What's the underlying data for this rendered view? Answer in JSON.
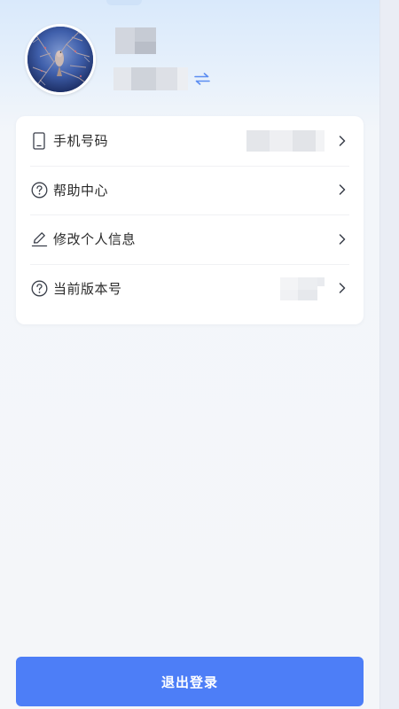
{
  "profile": {
    "avatar_icon": "avatar-photo",
    "switch_icon": "swap-arrows-icon"
  },
  "menu": {
    "items": [
      {
        "label": "手机号码",
        "icon": "phone-icon",
        "has_value": true
      },
      {
        "label": "帮助中心",
        "icon": "question-circle-icon",
        "has_value": false
      },
      {
        "label": "修改个人信息",
        "icon": "pencil-icon",
        "has_value": false
      },
      {
        "label": "当前版本号",
        "icon": "question-circle-icon",
        "has_value": true
      }
    ]
  },
  "logout": {
    "label": "退出登录"
  },
  "colors": {
    "accent": "#4d7ef7",
    "icon": "#3a3f4a",
    "switch": "#5b8df2"
  }
}
